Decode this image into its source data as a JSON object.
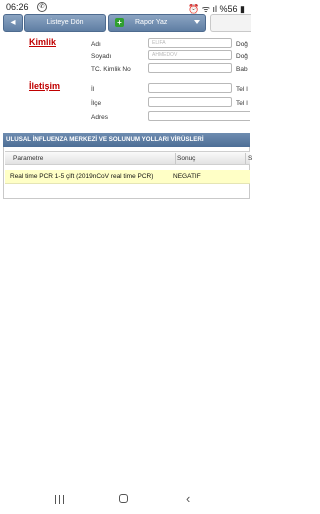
{
  "status_bar": {
    "time": "06:26",
    "notification_icon": "whatsapp-icon",
    "right_text": "⏰ ᯤ ıl %56 ▮"
  },
  "toolbar": {
    "back_icon": "left-arrow-icon",
    "back_label": "Listeye Dön",
    "report_icon": "plus-icon",
    "report_label": "Rapor Yaz",
    "report_dropdown_icon": "dropdown-arrow-icon"
  },
  "identity": {
    "title": "Kimlik",
    "fields": [
      {
        "label": "Adı",
        "value": "ELIFA",
        "right_label": "Doğ"
      },
      {
        "label": "Soyadı",
        "value": "AHMEDOV",
        "right_label": "Doğ"
      },
      {
        "label": "TC. Kimlik No",
        "value": "",
        "right_label": "Bab"
      }
    ]
  },
  "contact": {
    "title": "İletişim",
    "fields": [
      {
        "label": "İl",
        "value": "",
        "right_label": "Tel I"
      },
      {
        "label": "İlçe",
        "value": "",
        "right_label": "Tel I"
      },
      {
        "label": "Adres",
        "value": ""
      }
    ]
  },
  "panel": {
    "title": "ULUSAL İNFLUENZA MERKEZİ VE SOLUNUM YOLLARI VİRÜSLERİ",
    "columns": [
      "Parametre",
      "Sonuç",
      "S"
    ],
    "rows": [
      {
        "parametre": "Real time PCR 1-5 çift (2019nCoV real time PCR)",
        "sonuc": "NEGATIF"
      }
    ]
  },
  "nav_bar": {
    "recent_icon": "recent-apps-icon",
    "home_icon": "home-icon",
    "back_icon": "back-icon",
    "back_glyph": "‹"
  }
}
